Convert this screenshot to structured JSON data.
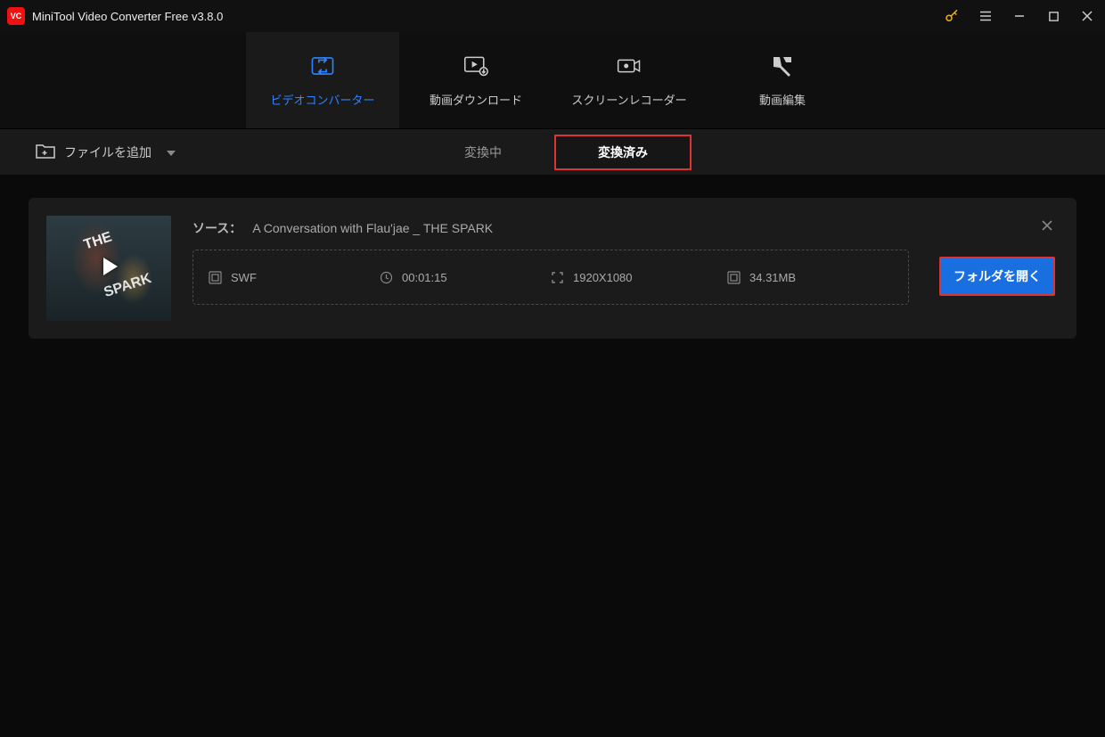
{
  "titlebar": {
    "app_name": "MiniTool Video Converter Free v3.8.0"
  },
  "nav": {
    "tabs": [
      {
        "label": "ビデオコンバーター"
      },
      {
        "label": "動画ダウンロード"
      },
      {
        "label": "スクリーンレコーダー"
      },
      {
        "label": "動画編集"
      }
    ]
  },
  "toolbar": {
    "add_file_label": "ファイルを追加",
    "status_tabs": {
      "converting": "変換中",
      "converted": "変換済み"
    }
  },
  "item": {
    "source_label": "ソース：",
    "source_name": "A Conversation with Flau'jae _ THE SPARK",
    "format": "SWF",
    "duration": "00:01:15",
    "resolution": "1920X1080",
    "size": "34.31MB",
    "open_folder_label": "フォルダを開く",
    "thumb_text1": "THE",
    "thumb_text2": "SPARK"
  }
}
